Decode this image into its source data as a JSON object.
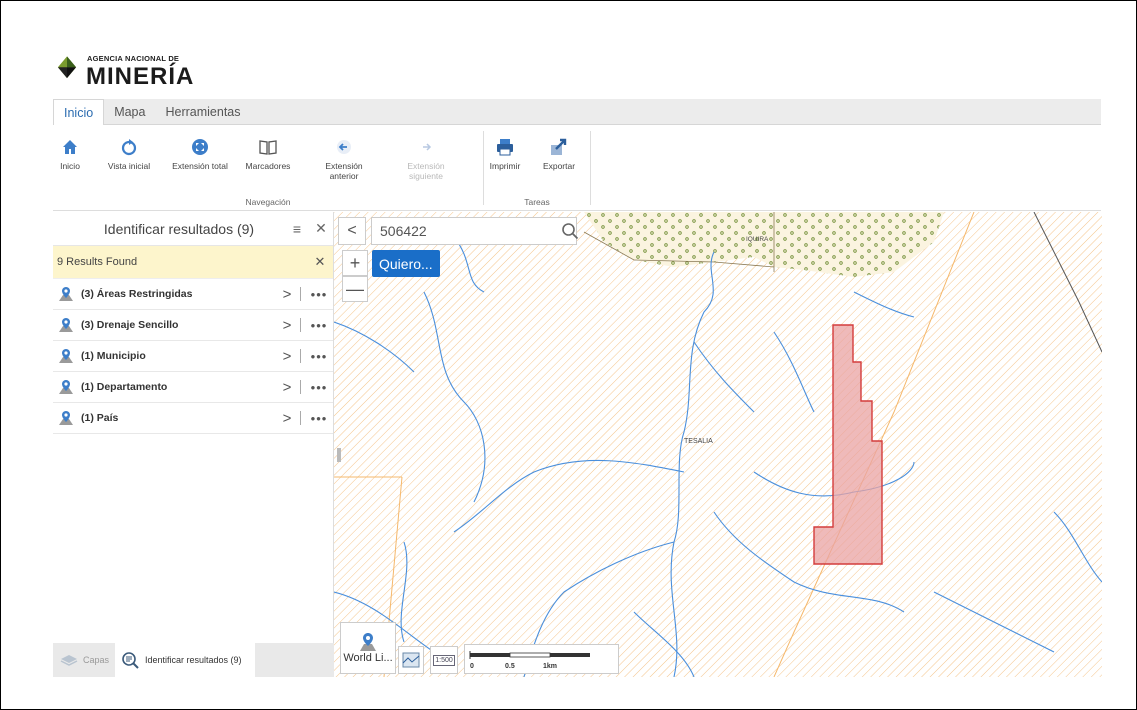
{
  "logo": {
    "top_text": "AGENCIA NACIONAL DE",
    "main_text": "MINERÍA"
  },
  "tabs": [
    {
      "label": "Inicio",
      "active": true
    },
    {
      "label": "Mapa",
      "active": false
    },
    {
      "label": "Herramientas",
      "active": false
    }
  ],
  "ribbon": {
    "nav_group": "Navegación",
    "tasks_group": "Tareas",
    "buttons": {
      "inicio": "Inicio",
      "vista_inicial": "Vista inicial",
      "extension_total": "Extensión total",
      "marcadores": "Marcadores",
      "extension_anterior_1": "Extensión",
      "extension_anterior_2": "anterior",
      "extension_siguiente_1": "Extensión",
      "extension_siguiente_2": "siguiente",
      "imprimir": "Imprimir",
      "exportar": "Exportar"
    }
  },
  "panel": {
    "title": "Identificar resultados (9)",
    "results_found": "9 Results Found",
    "results": [
      {
        "label": "(3) Áreas Restringidas"
      },
      {
        "label": "(3) Drenaje Sencillo"
      },
      {
        "label": "(1) Municipio"
      },
      {
        "label": "(1) Departamento"
      },
      {
        "label": "(1) País"
      }
    ],
    "footer_tabs": {
      "capas": "Capas",
      "identificar": "Identificar resultados (9)"
    }
  },
  "map": {
    "search_value": "506422",
    "quiero_label": "Quiero...",
    "place_tesalia": "TESALIA",
    "place_iquira": "IQUIRA",
    "basemap_label": "World Li...",
    "scale_badge": "1:500",
    "scale_ticks": [
      "0",
      "0.5",
      "1km"
    ]
  },
  "colors": {
    "accent": "#1a6ec8",
    "hatch": "#f5c58c",
    "river": "#4a8fdc",
    "polygon_fill": "#e9a3a3",
    "polygon_stroke": "#d43c3c",
    "results_bar": "#fdf5cc"
  }
}
